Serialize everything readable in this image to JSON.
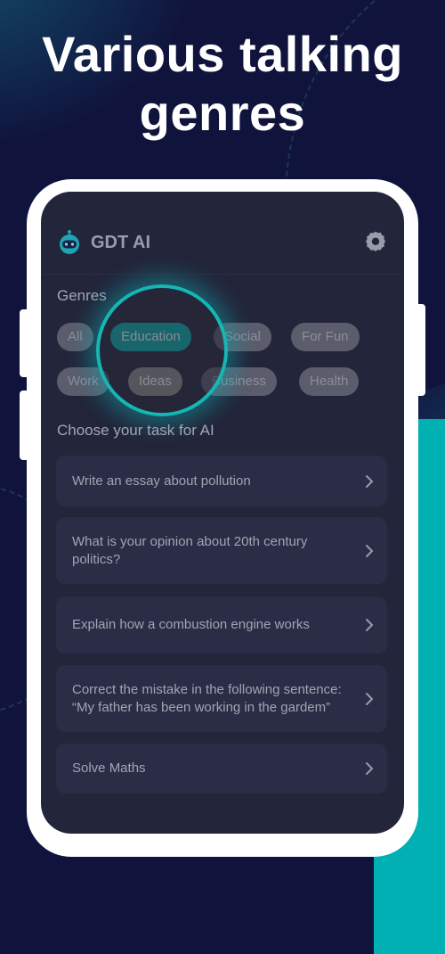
{
  "headline": {
    "line1": "Various talking",
    "line2": "genres"
  },
  "app": {
    "title": "GDT AI",
    "logo_icon": "robot-icon",
    "settings_icon": "gear-icon"
  },
  "genres": {
    "label": "Genres",
    "selected": "Education",
    "highlighted": "Ideas",
    "items": [
      {
        "label": "All"
      },
      {
        "label": "Education"
      },
      {
        "label": "Social"
      },
      {
        "label": "For Fun"
      },
      {
        "label": "Work"
      },
      {
        "label": "Ideas"
      },
      {
        "label": "Business"
      },
      {
        "label": "Health"
      }
    ]
  },
  "tasks": {
    "label": "Choose your task for AI",
    "items": [
      {
        "text": "Write an essay about pollution"
      },
      {
        "text": "What is your opinion about 20th century politics?"
      },
      {
        "text": "Explain how a combustion engine works"
      },
      {
        "text": "Correct the mistake in the following sentence: “My father has been working in the gardem”"
      },
      {
        "text": "Solve Maths"
      }
    ],
    "chevron_icon": "chevron-right-icon"
  },
  "colors": {
    "background": "#10143d",
    "accent": "#07b0b0",
    "screen": "#23253a",
    "card": "#2b2c45"
  }
}
